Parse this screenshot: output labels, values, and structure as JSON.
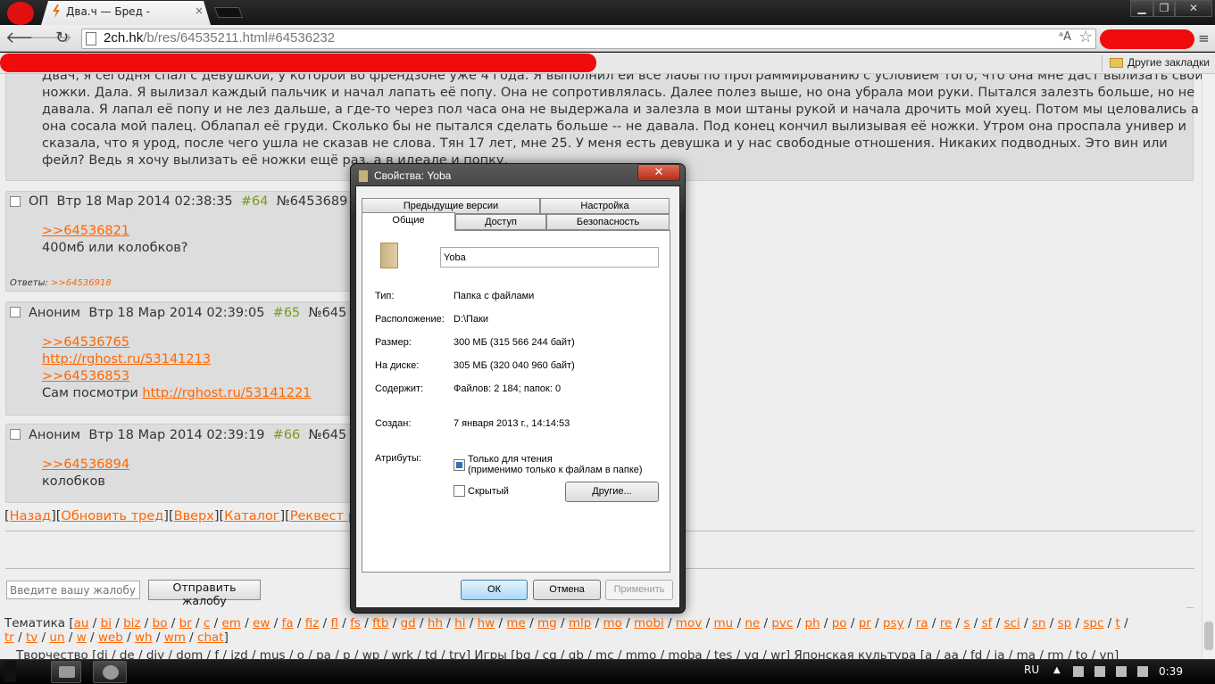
{
  "browser": {
    "tab_title": "Два.ч — Бред -",
    "tab_close": "×",
    "url_host": "2ch.hk",
    "url_path": "/b/res/64535211.html#64536232",
    "bookmarks_other": "Другие закладки",
    "window_controls": {
      "minimize": "▁",
      "maximize": "❐",
      "close": "✕"
    },
    "icons": {
      "back": "arrow-left-icon",
      "forward": "arrow-right-icon",
      "reload": "reload-icon",
      "translate": "translate-icon",
      "star": "star-icon",
      "menu": "menu-icon"
    }
  },
  "thread": {
    "op_text": [
      "Двач, я сегодня спал с девушкой, у которой во френдзоне уже 4 года. Я выполнил ей все лабы по программированию с условием того, что она мне даст вылизать свои",
      "ножки. Дала. Я вылизал каждый пальчик и начал лапать её попу. Она не сопротивлялась. Далее полез выше, но она убрала мои руки. Пытался залезть больше, но не",
      "давала. Я лапал её попу и не лез дальше, а где-то через пол часа она не выдержала и залезла в мои штаны рукой и начала дрочить мой хуец. Потом мы целовались а",
      "она сосала мой палец. Облапал её груди. Сколько бы не пытался сделать больше -- не давала. Под конец кончил вылизывая её ножки. Утром она проспала универ и",
      "сказала, что я урод, после чего ушла не сказав не слова. Тян 17 лет, мне 25. У меня есть девушка и у нас свободные отношения. Никаких подводных. Это вин или",
      "фейл? Ведь я хочу вылизать её ножки ещё раз, а в идеале и попку."
    ],
    "posts": [
      {
        "author": "ОП",
        "date": "Втр 18 Мар 2014 02:38:35",
        "num": "#64",
        "id": "№6453689",
        "lines": [
          {
            "link": ">>64536821"
          },
          {
            "text": "400мб или колобков?"
          }
        ],
        "replies_label": "Ответы:",
        "replies_link": ">>64536918"
      },
      {
        "author": "Аноним",
        "date": "Втр 18 Мар 2014 02:39:05",
        "num": "#65",
        "id": "№645",
        "lines": [
          {
            "link": ">>64536765"
          },
          {
            "link": "http://rghost.ru/53141213"
          },
          {
            "link": ">>64536853"
          },
          {
            "text": "Сам посмотри ",
            "link": "http://rghost.ru/53141221"
          }
        ]
      },
      {
        "author": "Аноним",
        "date": "Втр 18 Мар 2014 02:39:19",
        "num": "#66",
        "id": "№645",
        "lines": [
          {
            "link": ">>64536894"
          },
          {
            "text": "колобков"
          }
        ]
      }
    ],
    "nav_links": [
      "Назад",
      "Обновить тред",
      "Вверх",
      "Каталог",
      "Реквест раз"
    ],
    "complaint_placeholder": "Введите вашу жалобу сн",
    "complaint_button": "Отправить жалобу",
    "boards_line1_label": "Тематика [",
    "boards_line1": [
      "au",
      "bi",
      "biz",
      "bo",
      "br",
      "c",
      "em",
      "ew",
      "fa",
      "fiz",
      "fl",
      "fs",
      "ftb",
      "gd",
      "hh",
      "hi",
      "hw",
      "me",
      "mg",
      "mlp",
      "mo",
      "mobi",
      "mov",
      "mu",
      "ne",
      "pvc",
      "ph",
      "po",
      "pr",
      "psy",
      "ra",
      "re",
      "s",
      "sf",
      "sci",
      "sn",
      "sp",
      "spc",
      "t"
    ],
    "boards_line2": [
      "tr",
      "tv",
      "un",
      "w",
      "web",
      "wh",
      "wm",
      "chat"
    ],
    "boards_line3": "Творчество [di / de / diy / dom / f / izd / mus / o / pa / p / wp / wrk / td / trv]   Игры [bg / cg / gb / mc / mmo / moba / tes / vg / wr]   Японская культура [a / aa / fd / ja / ma / rm / to / vn]"
  },
  "dialog": {
    "title": "Свойства: Yoba",
    "close": "✕",
    "tabs_top": [
      "Предыдущие версии",
      "Настройка"
    ],
    "tabs_bottom": [
      "Общие",
      "Доступ",
      "Безопасность"
    ],
    "name": "Yoba",
    "props": [
      {
        "label": "Тип:",
        "value": "Папка с файлами"
      },
      {
        "label": "Расположение:",
        "value": "D:\\Паки"
      },
      {
        "label": "Размер:",
        "value": "300 МБ (315 566 244 байт)"
      },
      {
        "label": "На диске:",
        "value": "305 МБ (320 040 960 байт)"
      },
      {
        "label": "Содержит:",
        "value": "Файлов: 2 184; папок: 0"
      }
    ],
    "created_label": "Создан:",
    "created_value": "7 января 2013 г., 14:14:53",
    "attributes_label": "Атрибуты:",
    "readonly_line1": "Только для чтения",
    "readonly_line2": "(применимо только к файлам в папке)",
    "hidden_label": "Скрытый",
    "other_button": "Другие...",
    "ok": "ОК",
    "cancel": "Отмена",
    "apply": "Применить"
  },
  "taskbar": {
    "lang": "RU",
    "clock": "0:39",
    "tray_arrow": "▲"
  }
}
